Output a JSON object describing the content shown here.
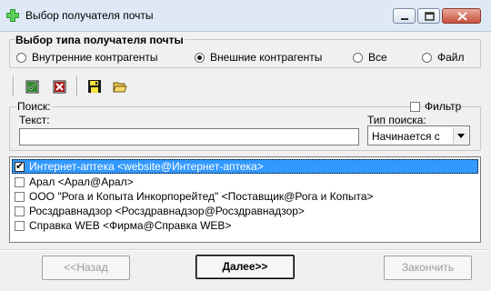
{
  "window": {
    "title": "Выбор получателя почты"
  },
  "recipient_type": {
    "legend": "Выбор типа получателя почты",
    "options": [
      {
        "label": "Внутренние контрагенты",
        "selected": false
      },
      {
        "label": "Внешние контрагенты",
        "selected": true
      },
      {
        "label": "Все",
        "selected": false
      },
      {
        "label": "Файл",
        "selected": false
      }
    ]
  },
  "toolbar": {
    "icons": [
      "check-all-icon",
      "uncheck-all-icon",
      "save-icon",
      "open-folder-icon"
    ]
  },
  "search": {
    "legend": "Поиск:",
    "filter_label": "Фильтр",
    "filter_checked": false,
    "text_label": "Текст:",
    "text_value": "",
    "type_label": "Тип поиска:",
    "type_value": "Начинается с"
  },
  "recipients": [
    {
      "label": "Интернет-аптека <website@Интернет-аптека>",
      "checked": true,
      "selected": true
    },
    {
      "label": "Арал <Арал@Арал>",
      "checked": false,
      "selected": false
    },
    {
      "label": "ООО \"Рога и Копыта Инкорпорейтед\" <Поставщик@Рога и Копыта>",
      "checked": false,
      "selected": false
    },
    {
      "label": "Росздравнадзор <Росздравнадзор@Росздравнадзор>",
      "checked": false,
      "selected": false
    },
    {
      "label": "Справка WEB <Фирма@Справка WEB>",
      "checked": false,
      "selected": false
    }
  ],
  "buttons": {
    "back": "<<Назад",
    "next": "Далее>>",
    "finish": "Закончить"
  },
  "colors": {
    "selection": "#3399ff",
    "titlebar": "#dfe9f5"
  }
}
